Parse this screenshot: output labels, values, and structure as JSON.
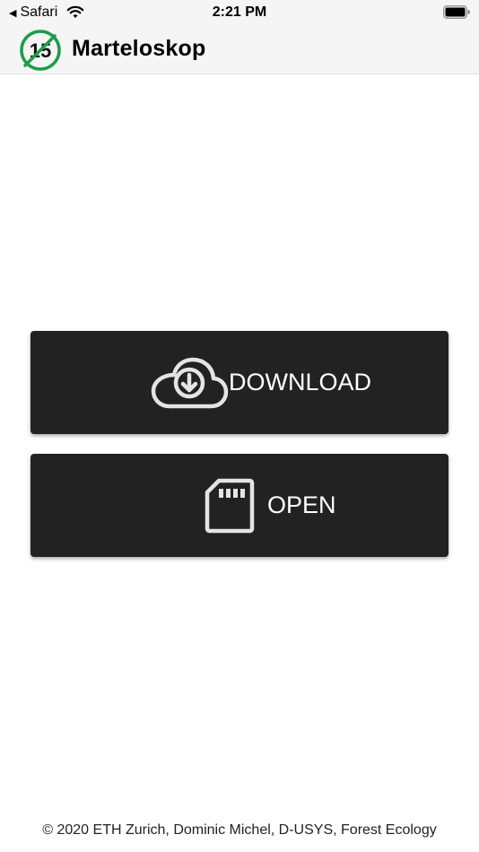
{
  "status_bar": {
    "back_label": "Safari",
    "time": "2:21 PM"
  },
  "header": {
    "logo_number": "15",
    "title": "Marteloskop"
  },
  "buttons": {
    "download_label": "DOWNLOAD",
    "open_label": "OPEN"
  },
  "footer": {
    "copyright": "© 2020 ETH Zurich, Dominic Michel, D-USYS, Forest Ecology"
  },
  "colors": {
    "button_bg": "#222222",
    "logo_green": "#1e9c4a",
    "header_bg": "#f5f5f5"
  },
  "icons": [
    "back-arrow-icon",
    "wifi-icon",
    "battery-icon",
    "cloud-download-icon",
    "sd-card-icon"
  ]
}
